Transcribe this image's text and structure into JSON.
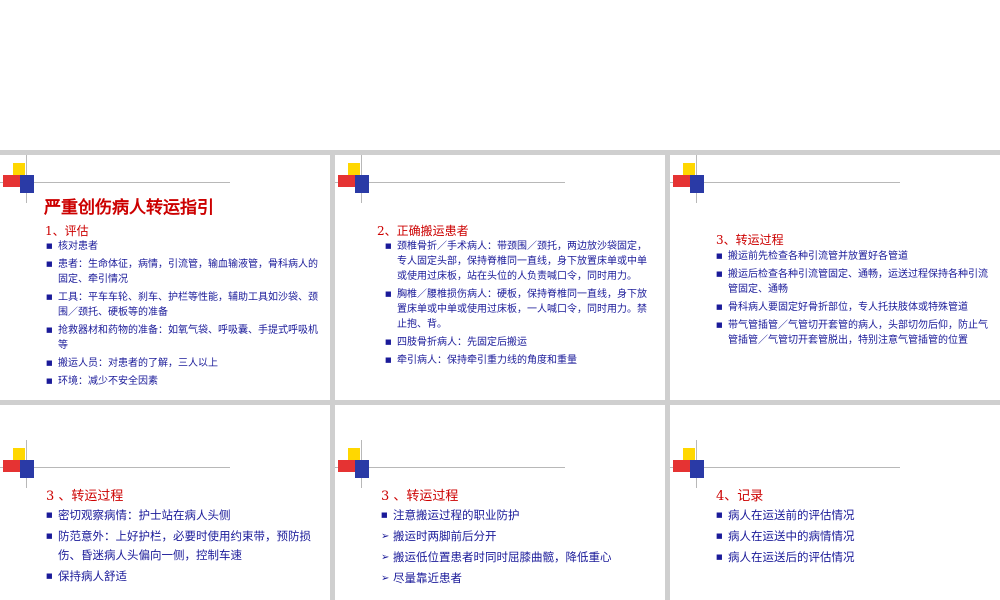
{
  "slides": [
    {
      "title": "严重创伤病人转运指引",
      "heading": "1、评估",
      "items": [
        "核对患者",
        "患者：生命体征，病情，引流管，输血输液管，骨科病人的固定、牵引情况",
        "工具：平车车轮、刹车、护栏等性能，辅助工具如沙袋、颈围／颈托、硬板等的准备",
        "抢救器材和药物的准备：如氧气袋、呼吸囊、手提式呼吸机等",
        "搬运人员：对患者的了解，三人以上",
        "环境：减少不安全因素"
      ]
    },
    {
      "heading": "2、正确搬运患者",
      "items": [
        "颈椎骨折／手术病人：带颈围／颈托，两边放沙袋固定，专人固定头部，保持脊椎同一直线，身下放置床单或中单或使用过床板，站在头位的人负责喊口令，同时用力。",
        "胸椎／腰椎损伤病人：硬板，保持脊椎同一直线，身下放置床单或中单或使用过床板，一人喊口令，同时用力。禁止抱、背。",
        "四肢骨折病人：先固定后搬运",
        "牵引病人：保持牵引重力线的角度和重量"
      ]
    },
    {
      "heading": "3、转运过程",
      "items": [
        "搬运前先检查各种引流管并放置好各管道",
        "搬运后检查各种引流管固定、通畅，运送过程保持各种引流管固定、通畅",
        "骨科病人要固定好骨折部位，专人托扶肢体或特殊管道",
        "带气管插管／气管切开套管的病人，头部切勿后仰，防止气管插管／气管切开套管脱出，特别注意气管插管的位置"
      ]
    },
    {
      "heading": "3 、转运过程",
      "items": [
        "密切观察病情：护士站在病人头侧",
        "防范意外：上好护栏，必要时使用约束带，预防损伤、昏迷病人头偏向一侧，控制车速",
        "保持病人舒适"
      ]
    },
    {
      "heading": "3 、转运过程",
      "items": [
        {
          "text": "注意搬运过程的职业防护",
          "bullet": "square"
        },
        {
          "text": "搬运时两脚前后分开",
          "bullet": "arrow"
        },
        {
          "text": "搬运低位置患者时同时屈膝曲髋，降低重心",
          "bullet": "arrow"
        },
        {
          "text": "尽量靠近患者",
          "bullet": "arrow"
        }
      ]
    },
    {
      "heading": "4、记录",
      "items": [
        "病人在运送前的评估情况",
        "病人在运送中的病情情况",
        "病人在运送后的评估情况"
      ]
    }
  ],
  "bullets": {
    "square": "■",
    "arrow": "➢"
  }
}
